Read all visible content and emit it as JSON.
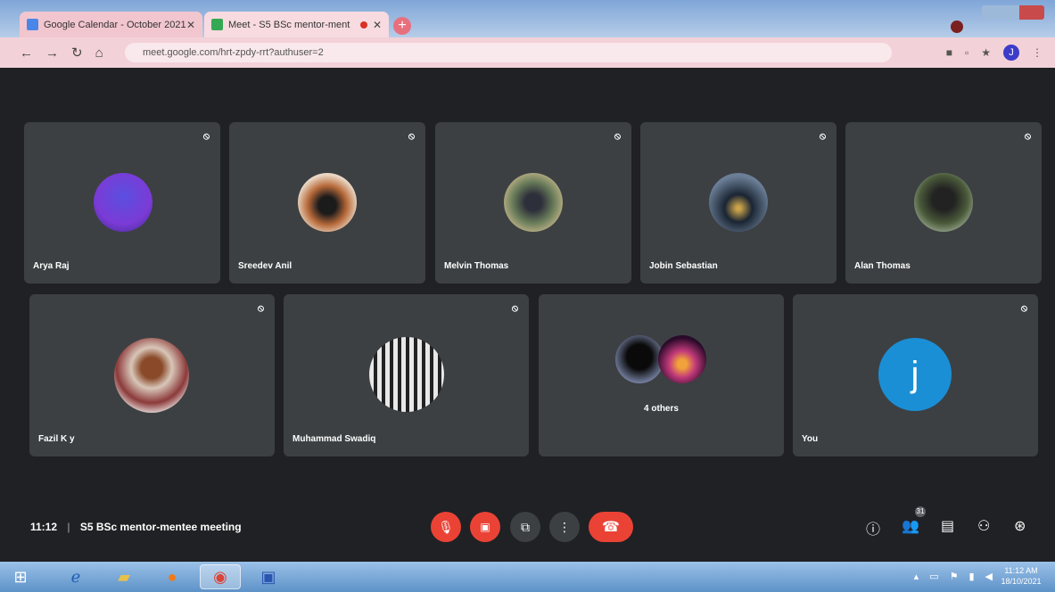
{
  "browser": {
    "tabs": [
      {
        "title": "Google Calendar - October 2021",
        "active": false
      },
      {
        "title": "Meet - S5 BSc mentor-ment",
        "active": true
      }
    ],
    "url": "meet.google.com/hrt-zpdy-rrt?authuser=2",
    "profile_initial": "J"
  },
  "participants": [
    {
      "name": "Arya Raj",
      "muted_icon": "mic-off-icon"
    },
    {
      "name": "Sreedev Anil",
      "muted_icon": "mic-off-icon"
    },
    {
      "name": "Melvin Thomas",
      "muted_icon": "mic-off-icon"
    },
    {
      "name": "Jobin Sebastian",
      "muted_icon": "mic-off-icon"
    },
    {
      "name": "Alan Thomas",
      "muted_icon": "mic-off-icon"
    },
    {
      "name": "Fazil K y",
      "muted_icon": "mic-off-icon"
    },
    {
      "name": "Muhammad Swadiq",
      "muted_icon": "mic-off-icon"
    },
    {
      "name": "4 others",
      "muted_icon": ""
    },
    {
      "name": "You",
      "muted_icon": "mic-off-icon",
      "initial": "j"
    }
  ],
  "meeting": {
    "time": "11:12",
    "separator": "|",
    "title": "S5 BSc mentor-mentee meeting",
    "people_count": "31"
  },
  "controls": {
    "mic": "mic-off-icon",
    "camera": "camera-off-icon",
    "present": "present-icon",
    "more": "more-vert-icon",
    "end": "end-call-icon"
  },
  "side_icons": [
    "info-icon",
    "people-icon",
    "chat-icon",
    "activities-icon",
    "host-controls-icon"
  ],
  "taskbar": {
    "clock_time": "11:12 AM",
    "clock_date": "18/10/2021"
  },
  "colors": {
    "meet_bg": "#202124",
    "tile_bg": "#3c4043",
    "red": "#ea4335",
    "you_avatar": "#1a8fd6"
  }
}
